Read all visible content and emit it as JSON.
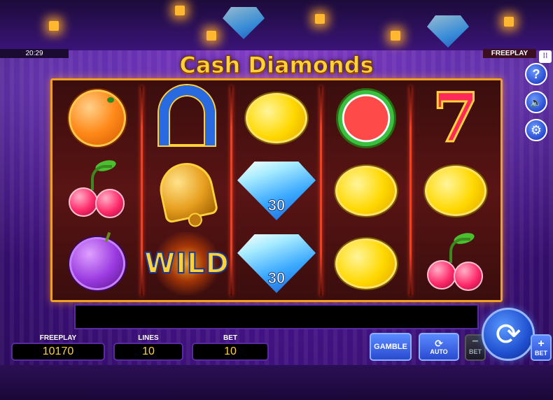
{
  "status": {
    "clock": "20:29",
    "mode": "FREEPLAY"
  },
  "logo": {
    "title": "Cash Diamonds"
  },
  "side_buttons": [
    {
      "name": "help",
      "glyph": "?"
    },
    {
      "name": "sound",
      "glyph": "🔈"
    },
    {
      "name": "settings",
      "glyph": "⚙"
    }
  ],
  "reels": {
    "grid": [
      [
        "orange",
        "horseshoe",
        "lemon",
        "watermelon",
        "seven"
      ],
      [
        "cherry",
        "bell",
        "diamond",
        "lemon",
        "lemon"
      ],
      [
        "plum",
        "wild",
        "diamond",
        "lemon",
        "cherry"
      ]
    ],
    "diamond_values": [
      "30",
      "30"
    ],
    "wild_label": "WILD",
    "seven_label": "7"
  },
  "bottom_bar": {
    "balance": {
      "label": "FREEPLAY",
      "value": "10170"
    },
    "lines": {
      "label": "LINES",
      "value": "10"
    },
    "bet": {
      "label": "BET",
      "value": "10"
    },
    "gamble_label": "GAMBLE",
    "auto_label": "AUTO",
    "bet_minus_label": "BET",
    "bet_plus_label": "BET",
    "spin_glyph": "⟳"
  },
  "colors": {
    "frame": "#f0a020",
    "accent": "#ffd23a",
    "button": "#2a4ad0"
  }
}
